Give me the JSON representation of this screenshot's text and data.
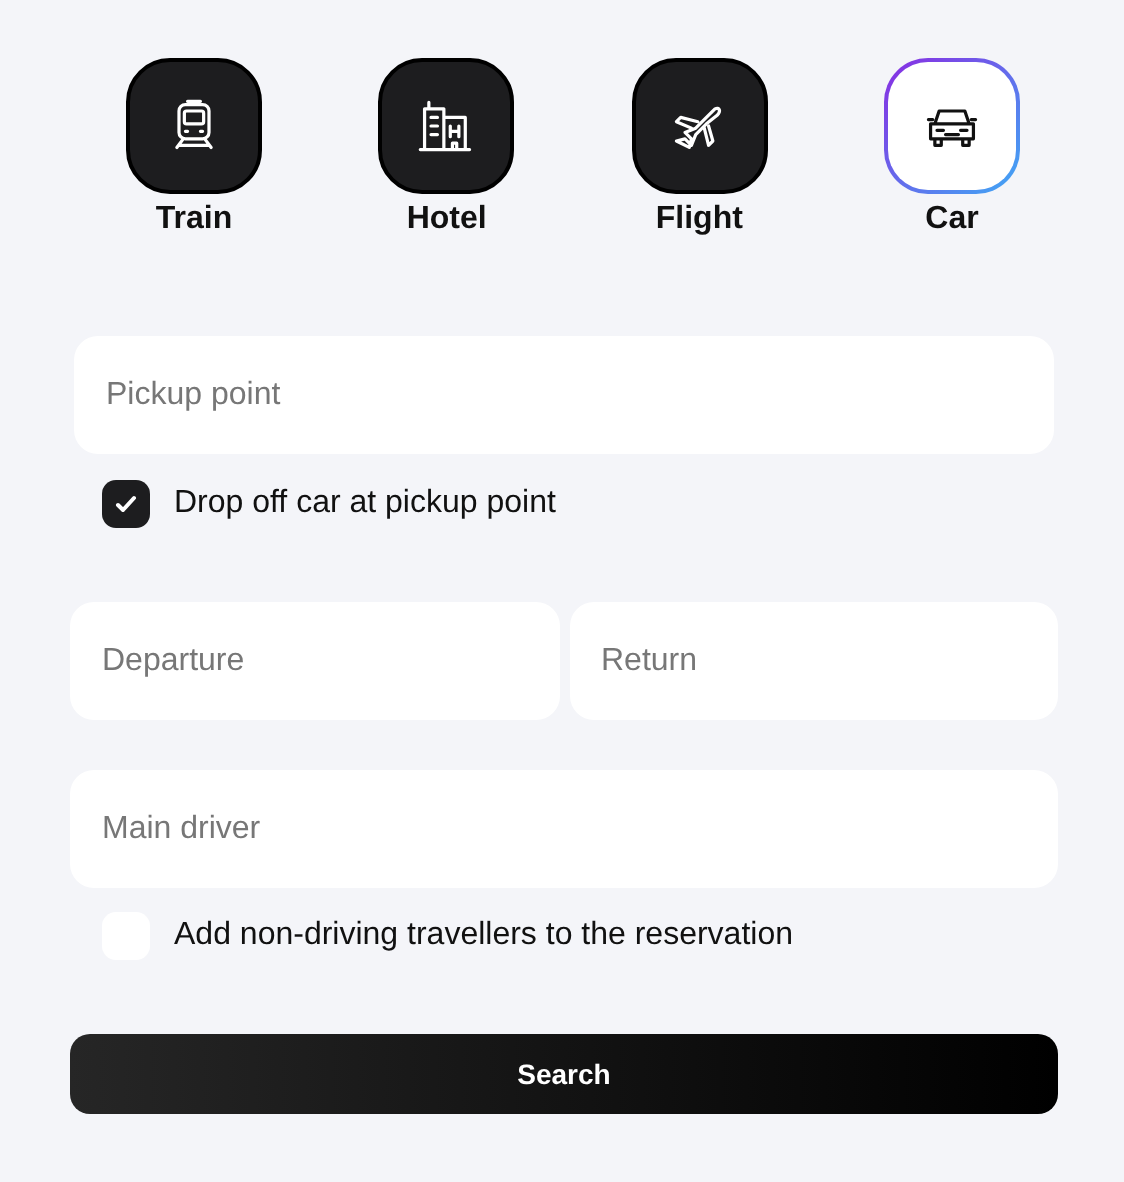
{
  "tabs": [
    {
      "kind": "train",
      "label": "Train",
      "selected": false
    },
    {
      "kind": "hotel",
      "label": "Hotel",
      "selected": false
    },
    {
      "kind": "flight",
      "label": "Flight",
      "selected": false
    },
    {
      "kind": "car",
      "label": "Car",
      "selected": true
    }
  ],
  "pickup": {
    "placeholder": "Pickup point"
  },
  "same_dropoff": {
    "label": "Drop off car at pickup point",
    "checked": true
  },
  "dates": [
    {
      "placeholder": "Departure"
    },
    {
      "placeholder": "Return"
    }
  ],
  "driver": {
    "placeholder": "Main driver"
  },
  "travellers": {
    "label": "Add non-driving travellers to the reservation",
    "checked": false
  },
  "button": "Search"
}
